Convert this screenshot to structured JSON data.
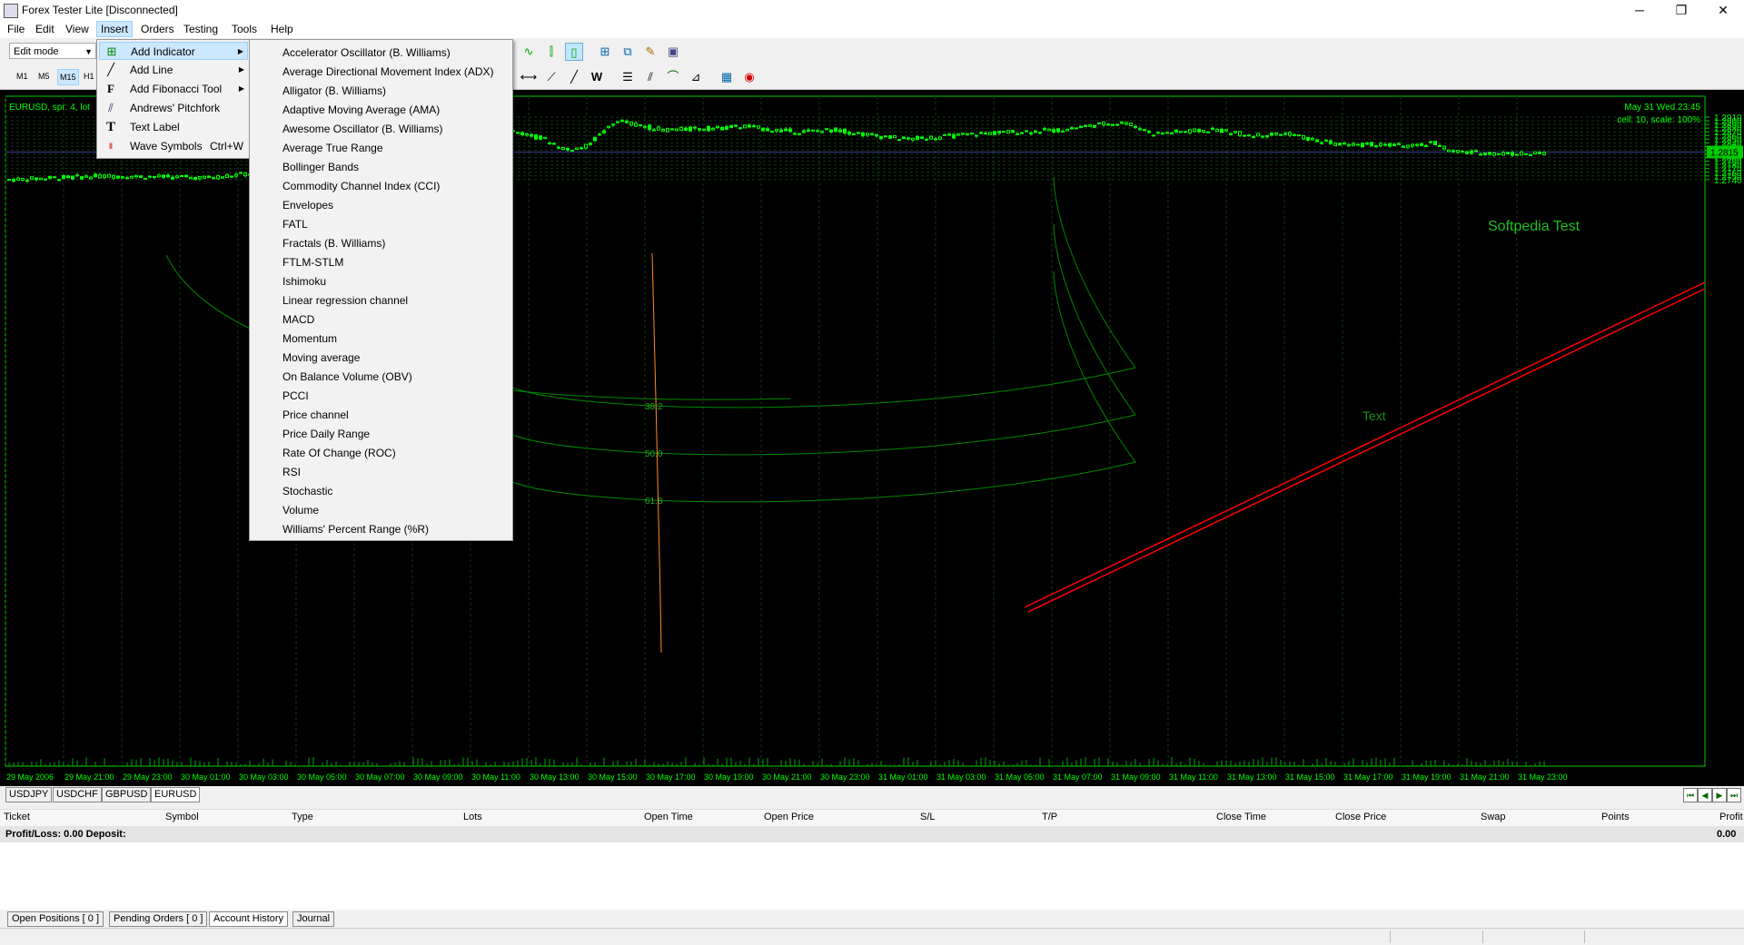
{
  "window": {
    "title": "Forex Tester Lite [Disconnected]"
  },
  "menubar": {
    "items": [
      "File",
      "Edit",
      "View",
      "Insert",
      "Orders",
      "Testing",
      "Tools",
      "Help"
    ]
  },
  "toolbar": {
    "mode_select": "Edit mode",
    "timeframes": [
      "M1",
      "M5",
      "M15",
      "H1"
    ]
  },
  "insert_menu": {
    "items": [
      {
        "label": "Add Indicator",
        "icon": "add-indicator-icon"
      },
      {
        "label": "Add Line",
        "icon": "line-icon"
      },
      {
        "label": "Add Fibonacci Tool",
        "icon": "fibonacci-icon"
      },
      {
        "label": "Andrews' Pitchfork",
        "icon": "pitchfork-icon"
      },
      {
        "label": "Text Label",
        "icon": "text-icon"
      },
      {
        "label": "Wave Symbols",
        "icon": "wave-icon",
        "shortcut": "Ctrl+W"
      }
    ],
    "icon_glyphs": {
      "text": "T",
      "fib": "F"
    }
  },
  "indicator_menu": {
    "items": [
      "Accelerator Oscillator (B. Williams)",
      "Average Directional Movement Index (ADX)",
      "Alligator (B. Williams)",
      "Adaptive Moving Average (AMA)",
      "Awesome Oscillator (B. Williams)",
      "Average True Range",
      "Bollinger Bands",
      "Commodity Channel Index (CCI)",
      "Envelopes",
      "FATL",
      "Fractals (B. Williams)",
      "FTLM-STLM",
      "Ishimoku",
      "Linear regression channel",
      "MACD",
      "Momentum",
      "Moving average",
      "On Balance Volume (OBV)",
      "PCCI",
      "Price channel",
      "Price Daily Range",
      "Rate Of Change (ROC)",
      "RSI",
      "Stochastic",
      "Volume",
      "Williams' Percent Range (%R)"
    ]
  },
  "chart": {
    "symbol_info": "EURUSD, spr: 4, lot",
    "datetime": "May 31 Wed 23:45",
    "cell_scale": "cell: 10, scale: 100%",
    "watermark": "Softpedia Test",
    "text_label": "Text",
    "fib_levels": [
      "38.2",
      "50.0",
      "61.8"
    ],
    "current_price": "1.2815",
    "price_ticks": [
      "1.2910",
      "1.2900",
      "1.2890",
      "1.2880",
      "1.2870",
      "1.2860",
      "1.2850",
      "1.2840",
      "1.2830",
      "1.2820",
      "1.2810",
      "1.2800",
      "1.2790",
      "1.2780",
      "1.2770",
      "1.2760",
      "1.2750",
      "1.2740"
    ],
    "time_ticks": [
      "29 May 2006",
      "29 May 21:00",
      "29 May 23:00",
      "30 May 01:00",
      "30 May 03:00",
      "30 May 05:00",
      "30 May 07:00",
      "30 May 09:00",
      "30 May 11:00",
      "30 May 13:00",
      "30 May 15:00",
      "30 May 17:00",
      "30 May 19:00",
      "30 May 21:00",
      "30 May 23:00",
      "31 May 01:00",
      "31 May 03:00",
      "31 May 05:00",
      "31 May 07:00",
      "31 May 09:00",
      "31 May 11:00",
      "31 May 13:00",
      "31 May 15:00",
      "31 May 17:00",
      "31 May 19:00",
      "31 May 21:00",
      "31 May 23:00"
    ],
    "colors": {
      "bg": "#000000",
      "candle": "#00ff00",
      "grid": "#0f3a0f",
      "axis": "#00cc00",
      "trendline": "#ff0000",
      "fib": "#008800",
      "vline": "#ff8c1a"
    }
  },
  "symbol_tabs": [
    "USDJPY",
    "USDCHF",
    "GBPUSD",
    "EURUSD"
  ],
  "table": {
    "columns": [
      "Ticket",
      "Symbol",
      "Type",
      "Lots",
      "Open Time",
      "Open Price",
      "S/L",
      "T/P",
      "Close Time",
      "Close Price",
      "Swap",
      "Points",
      "Profit"
    ],
    "pl_label": "Profit/Loss: 0.00 Deposit:",
    "pl_value": "0.00"
  },
  "bottom_tabs": [
    "Open Positions  [ 0 ]",
    "Pending Orders  [ 0 ]",
    "Account History",
    "Journal"
  ]
}
